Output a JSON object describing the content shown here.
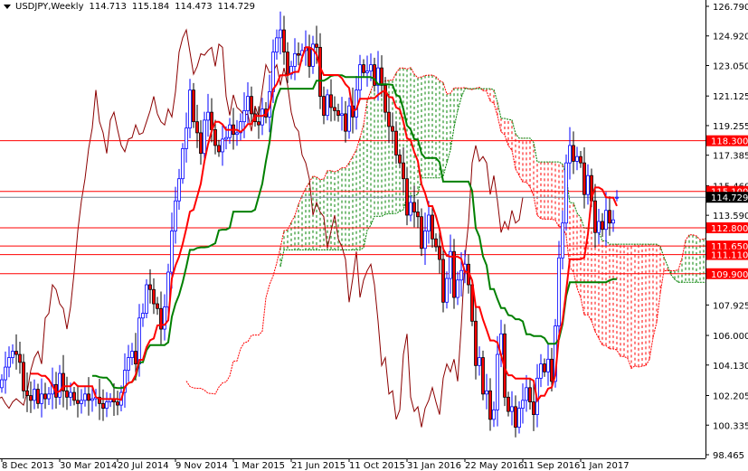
{
  "header": {
    "symbol": "USDJPY,Weekly",
    "open": "114.713",
    "high": "115.184",
    "low": "114.473",
    "close": "114.729"
  },
  "chart_data": {
    "type": "candlestick",
    "title": "USDJPY,Weekly",
    "timeframe": "Weekly",
    "ylim": [
      98.465,
      126.79
    ],
    "y_ticks": [
      "126.790",
      "124.920",
      "123.050",
      "121.125",
      "119.255",
      "117.385",
      "115.460",
      "113.590",
      "107.925",
      "106.000",
      "104.130",
      "102.205",
      "100.335",
      "98.465"
    ],
    "x_labels": [
      "8 Dec 2013",
      "30 Mar 2014",
      "20 Jul 2014",
      "9 Nov 2014",
      "1 Mar 2015",
      "21 Jun 2015",
      "11 Oct 2015",
      "31 Jan 2016",
      "22 May 2016",
      "11 Sep 2016",
      "1 Jan 2017"
    ],
    "x_label_every_weeks": 16,
    "last_ohlc": [
      114.713,
      115.184,
      114.473,
      114.729
    ],
    "closes": [
      103.2,
      104.0,
      104.6,
      105.0,
      104.8,
      104.3,
      102.5,
      102.2,
      101.9,
      102.6,
      101.7,
      102.3,
      102.0,
      102.3,
      102.9,
      102.1,
      103.6,
      102.5,
      102.1,
      102.4,
      101.9,
      101.7,
      101.9,
      102.3,
      101.9,
      102.0,
      102.1,
      101.7,
      101.4,
      101.8,
      102.0,
      101.8,
      101.6,
      102.4,
      103.8,
      104.6,
      105.0,
      104.2,
      107.1,
      107.4,
      109.2,
      108.9,
      108.0,
      107.7,
      106.4,
      107.8,
      110.0,
      112.6,
      114.5,
      115.9,
      117.8,
      119.1,
      121.5,
      119.5,
      118.8,
      117.5,
      119.6,
      120.1,
      119.0,
      118.0,
      117.6,
      118.4,
      118.5,
      119.3,
      118.7,
      118.8,
      119.5,
      120.2,
      121.1,
      120.0,
      119.5,
      119.3,
      120.3,
      119.8,
      121.4,
      123.9,
      124.8,
      125.3,
      123.9,
      122.5,
      123.0,
      123.8,
      123.7,
      124.0,
      124.2,
      123.0,
      124.4,
      124.2,
      121.1,
      119.9,
      121.2,
      120.4,
      120.2,
      119.9,
      120.0,
      118.9,
      120.5,
      119.8,
      121.5,
      123.1,
      122.6,
      122.7,
      123.1,
      121.8,
      122.9,
      121.8,
      120.1,
      119.2,
      118.9,
      117.4,
      116.9,
      115.9,
      113.6,
      114.4,
      113.8,
      113.5,
      111.5,
      112.6,
      113.6,
      112.1,
      111.6,
      110.8,
      108.1,
      109.6,
      111.3,
      108.4,
      109.5,
      110.1,
      110.5,
      109.2,
      106.9,
      104.1,
      104.6,
      102.3,
      102.5,
      100.7,
      101.3,
      104.8,
      106.1,
      102.1,
      101.2,
      101.5,
      100.2,
      101.4,
      101.9,
      102.7,
      101.8,
      101.0,
      103.3,
      104.2,
      103.7,
      104.5,
      103.1,
      106.6,
      110.9,
      113.1,
      116.9,
      118.0,
      117.0,
      117.3,
      116.9,
      114.9,
      116.1,
      114.5,
      112.5,
      113.2,
      112.7,
      113.9,
      113.1,
      113.3,
      114.729
    ],
    "ichimoku": {
      "tenkan": 9,
      "kijun": 26,
      "senkou_b": 52
    },
    "levels": [
      {
        "label": "118.300",
        "value": 118.3
      },
      {
        "label": "115.100",
        "value": 115.1
      },
      {
        "label": "112.800",
        "value": 112.8
      },
      {
        "label": "111.650",
        "value": 111.65
      },
      {
        "label": "111.110",
        "value": 111.11
      },
      {
        "label": "109.900",
        "value": 109.9
      }
    ],
    "bid": {
      "label": "114.729",
      "value": 114.729
    }
  },
  "colors": {
    "bull": "#0000ff",
    "bear_body": "#ff0000",
    "bear_wick": "#000000",
    "tenkan": "#ff0000",
    "kijun": "#008000",
    "chikou": "#8b0000",
    "cloud_up": "#008000",
    "cloud_down": "#ff0000",
    "level": "#ff0000",
    "bid_line": "#708090"
  }
}
